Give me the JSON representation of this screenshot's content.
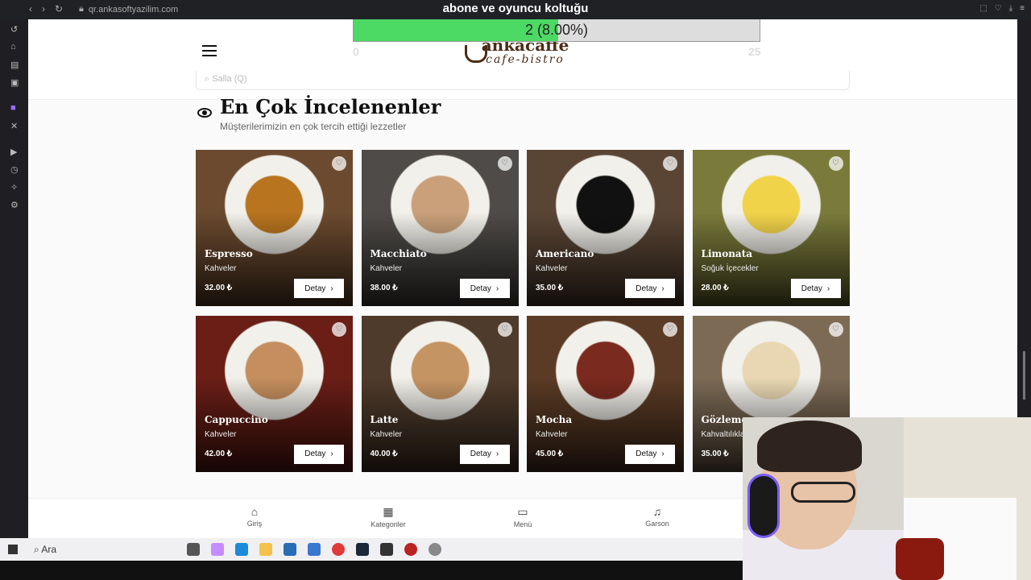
{
  "browser": {
    "url": "qr.ankasoftyazilim.com"
  },
  "stream": {
    "overlay_title": "abone ve oyuncu koltuğu",
    "progress_text": "2 (8.00%)",
    "progress_fraction": 0.08,
    "goal_left": "0",
    "goal_right": "25"
  },
  "header": {
    "logo_line1": "ankacaffe",
    "logo_line2": "cafe-bistro",
    "search_placeholder": "Salla (Q)"
  },
  "section": {
    "title": "En Çok İncelenenler",
    "subtitle": "Müşterilerimizin en çok tercih ettiği lezzetler"
  },
  "products": [
    {
      "name": "Espresso",
      "category": "Kahveler",
      "price": "32.00 ₺",
      "button": "Detay",
      "color": "#6b4a2f",
      "accent": "#b8741e"
    },
    {
      "name": "Macchiato",
      "category": "Kahveler",
      "price": "38.00 ₺",
      "button": "Detay",
      "color": "#4e4b48",
      "accent": "#c9a07a"
    },
    {
      "name": "Americano",
      "category": "Kahveler",
      "price": "35.00 ₺",
      "button": "Detay",
      "color": "#5a4535",
      "accent": "#111111"
    },
    {
      "name": "Limonata",
      "category": "Soğuk İçecekler",
      "price": "28.00 ₺",
      "button": "Detay",
      "color": "#7a7a3a",
      "accent": "#f1d34a"
    },
    {
      "name": "Cappuccino",
      "category": "Kahveler",
      "price": "42.00 ₺",
      "button": "Detay",
      "color": "#6a1e16",
      "accent": "#c48e5e"
    },
    {
      "name": "Latte",
      "category": "Kahveler",
      "price": "40.00 ₺",
      "button": "Detay",
      "color": "#4f3b2b",
      "accent": "#c59463"
    },
    {
      "name": "Mocha",
      "category": "Kahveler",
      "price": "45.00 ₺",
      "button": "Detay",
      "color": "#5b3b25",
      "accent": "#7a2a1e"
    },
    {
      "name": "Gözleme",
      "category": "Kahvaltılıklar",
      "price": "35.00 ₺",
      "button": "Detay",
      "color": "#7c6a55",
      "accent": "#e8d7b2"
    }
  ],
  "bottom_nav": [
    {
      "label": "Giriş",
      "icon": "home-icon"
    },
    {
      "label": "Kategoriler",
      "icon": "grid-icon"
    },
    {
      "label": "Menü",
      "icon": "book-icon"
    },
    {
      "label": "Garson",
      "icon": "bell-icon"
    }
  ],
  "taskbar": {
    "search_label": "Ara"
  }
}
